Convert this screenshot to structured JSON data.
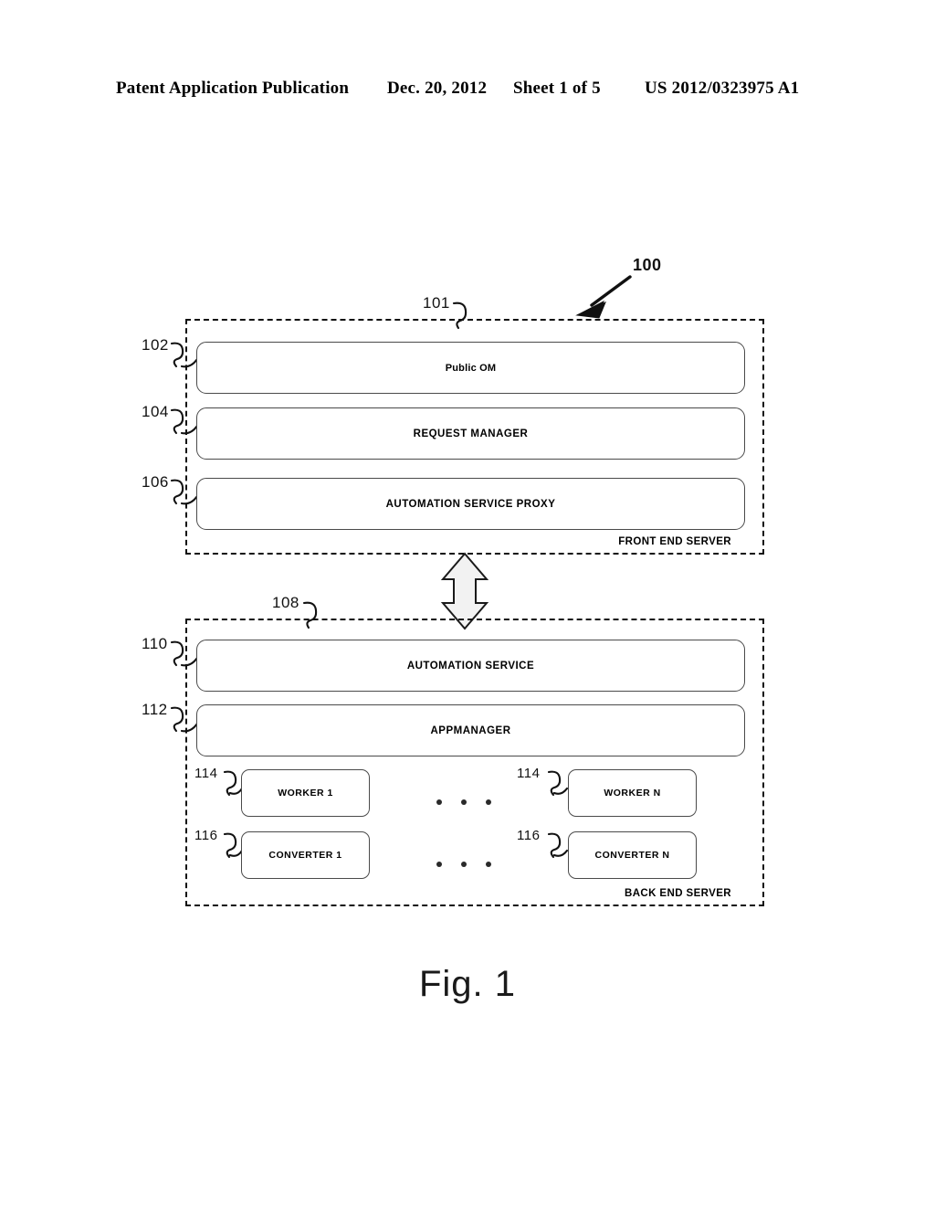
{
  "header": {
    "publication": "Patent Application Publication",
    "date": "Dec. 20, 2012",
    "sheet": "Sheet 1 of 5",
    "number": "US 2012/0323975 A1"
  },
  "figure": {
    "caption": "Fig. 1",
    "system_ref": "100",
    "colors": {
      "ink": "#111111",
      "box_stroke": "#4a4a4a",
      "background": "#ffffff"
    }
  },
  "front_end_server": {
    "ref": "101",
    "caption": "FRONT END SERVER",
    "components": [
      {
        "ref": "102",
        "label": "Public OM"
      },
      {
        "ref": "104",
        "label": "REQUEST MANAGER"
      },
      {
        "ref": "106",
        "label": "AUTOMATION SERVICE PROXY"
      }
    ]
  },
  "back_end_server": {
    "ref": "108",
    "caption": "BACK END SERVER",
    "components": [
      {
        "ref": "110",
        "label": "AUTOMATION SERVICE"
      },
      {
        "ref": "112",
        "label": "APPMANAGER"
      }
    ],
    "workers": [
      {
        "ref": "114",
        "label": "WORKER 1"
      },
      {
        "ref": "114",
        "label": "WORKER N"
      }
    ],
    "converters": [
      {
        "ref": "116",
        "label": "CONVERTER 1"
      },
      {
        "ref": "116",
        "label": "CONVERTER N"
      }
    ],
    "ellipsis": "• • •"
  },
  "connector": {
    "name": "bidirectional-arrow",
    "direction": "vertical-double-headed"
  }
}
